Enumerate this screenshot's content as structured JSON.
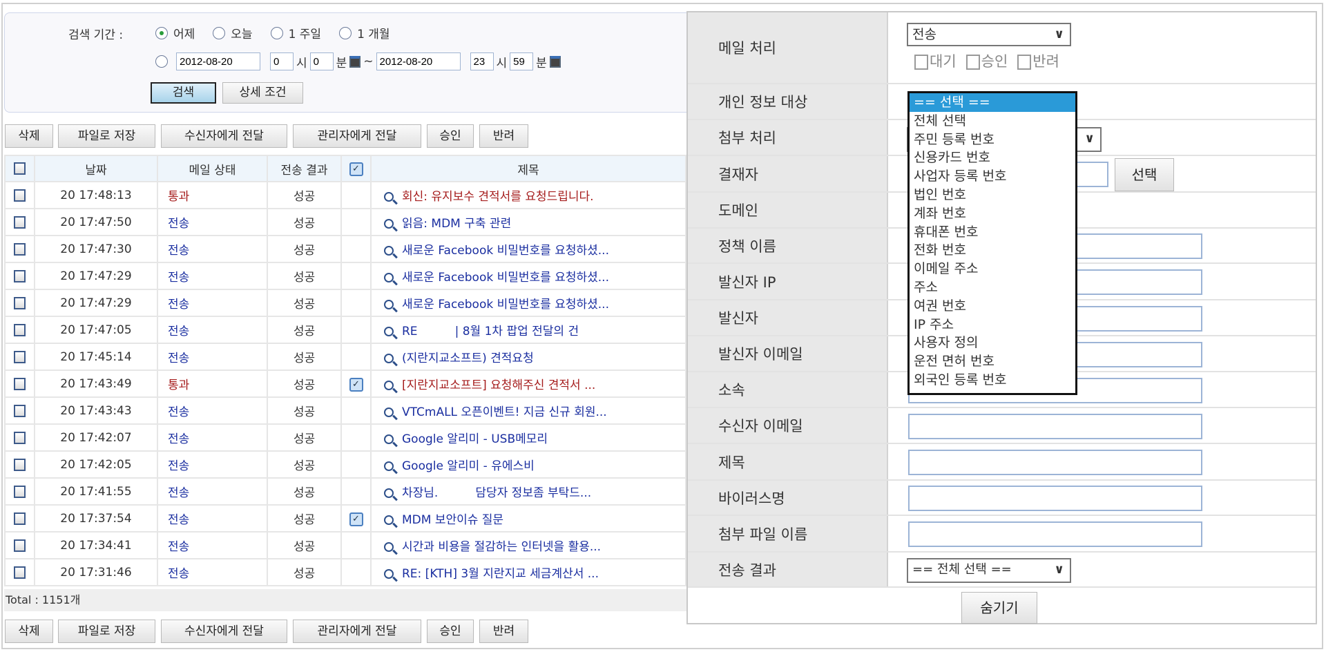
{
  "search": {
    "period_label": "검색 기간 :",
    "periods": [
      "어제",
      "오늘",
      "1 주일",
      "1 개월"
    ],
    "selected_period": "어제",
    "start_date": "2012-08-20",
    "start_hour": "0",
    "start_min": "0",
    "end_date": "2012-08-20",
    "end_hour": "23",
    "end_min": "59",
    "hour_unit": "시",
    "min_unit": "분",
    "tilde": "~",
    "search_btn": "검색",
    "detail_btn": "상세 조건"
  },
  "toolbar": [
    "삭제",
    "파일로 저장",
    "수신자에게 전달",
    "관리자에게 전달",
    "승인",
    "반려"
  ],
  "table": {
    "headers": [
      "날짜",
      "메일 상태",
      "전송 결과",
      "제목"
    ],
    "rows": [
      {
        "date": "20 17:48:13",
        "status": "통과",
        "result": "성공",
        "attach": false,
        "subject": "회신: 유지보수 견적서를 요청드립니다."
      },
      {
        "date": "20 17:47:50",
        "status": "전송",
        "result": "성공",
        "attach": false,
        "subject": "읽음: MDM 구축 관련"
      },
      {
        "date": "20 17:47:30",
        "status": "전송",
        "result": "성공",
        "attach": false,
        "subject": "새로운 Facebook 비밀번호를 요청하셨..."
      },
      {
        "date": "20 17:47:29",
        "status": "전송",
        "result": "성공",
        "attach": false,
        "subject": "새로운 Facebook 비밀번호를 요청하셨..."
      },
      {
        "date": "20 17:47:29",
        "status": "전송",
        "result": "성공",
        "attach": false,
        "subject": "새로운 Facebook 비밀번호를 요청하셨..."
      },
      {
        "date": "20 17:47:05",
        "status": "전송",
        "result": "성공",
        "attach": false,
        "subject": "RE          | 8월 1차 팝업 전달의 건"
      },
      {
        "date": "20 17:45:14",
        "status": "전송",
        "result": "성공",
        "attach": false,
        "subject": "(지란지교소프트) 견적요청"
      },
      {
        "date": "20 17:43:49",
        "status": "통과",
        "result": "성공",
        "attach": true,
        "subject": "[지란지교소프트] 요청해주신 견적서 ..."
      },
      {
        "date": "20 17:43:43",
        "status": "전송",
        "result": "성공",
        "attach": false,
        "subject": "VTCmALL 오픈이벤트! 지금 신규 회원..."
      },
      {
        "date": "20 17:42:07",
        "status": "전송",
        "result": "성공",
        "attach": false,
        "subject": "Google 알리미 - USB메모리"
      },
      {
        "date": "20 17:42:05",
        "status": "전송",
        "result": "성공",
        "attach": false,
        "subject": "Google 알리미 - 유에스비"
      },
      {
        "date": "20 17:41:55",
        "status": "전송",
        "result": "성공",
        "attach": false,
        "subject": "차장님.          담당자 정보좀 부탁드..."
      },
      {
        "date": "20 17:37:54",
        "status": "전송",
        "result": "성공",
        "attach": true,
        "subject": "MDM 보안이슈 질문"
      },
      {
        "date": "20 17:34:41",
        "status": "전송",
        "result": "성공",
        "attach": false,
        "subject": "시간과 비용을 절감하는 인터넷을 활용..."
      },
      {
        "date": "20 17:31:46",
        "status": "전송",
        "result": "성공",
        "attach": false,
        "subject": "RE: [KTH] 3월 지란지교 세금계산서 ..."
      }
    ],
    "total": "Total : 1151개"
  },
  "detail": {
    "labels": [
      "메일 처리",
      "개인 정보 대상",
      "첨부 처리",
      "결재자",
      "도메인",
      "정책 이름",
      "발신자 IP",
      "발신자",
      "발신자 이메일",
      "소속",
      "수신자 이메일",
      "제목",
      "바이러스명",
      "첨부 파일 이름",
      "전송 결과"
    ],
    "mail_action": "전송",
    "mail_checks": [
      "대기",
      "승인",
      "반려"
    ],
    "approver_btn": "선택",
    "result_select": "== 전체 선택 ==",
    "hide_btn": "숨기기",
    "privacy_options": [
      "== 선택 ==",
      "전체 선택",
      "주민 등록 번호",
      "신용카드 번호",
      "사업자 등록 번호",
      "법인 번호",
      "계좌 번호",
      "휴대폰 번호",
      "전화 번호",
      "이메일 주소",
      "주소",
      "여권 번호",
      "IP 주소",
      "사용자 정의",
      "운전 면허 번호",
      "외국인 등록 번호"
    ],
    "privacy_selected": "== 선택 =="
  },
  "colors": {
    "pass": "#a51c1c",
    "send": "#1a2ea0",
    "highlight": "#2a9ad8"
  }
}
